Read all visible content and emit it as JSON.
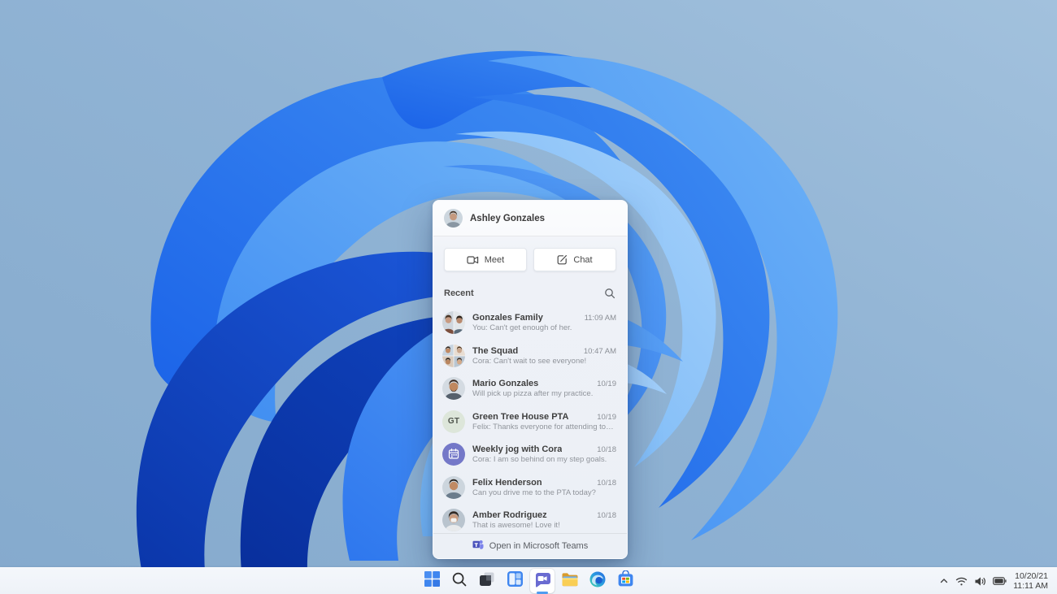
{
  "colors": {
    "accent_blue": "#2f7cf6",
    "teams_purple": "#6a6bd1",
    "wallpaper_deep_blue": "#0c3cb8",
    "taskbar_bg": "#f2f5fa"
  },
  "chat_panel": {
    "header": {
      "user_name": "Ashley Gonzales"
    },
    "actions": {
      "meet_label": "Meet",
      "chat_label": "Chat"
    },
    "recent_label": "Recent",
    "items": [
      {
        "name": "Gonzales Family",
        "preview": "You: Can't get enough of her.",
        "time": "11:09 AM",
        "avatar": "photo-pair"
      },
      {
        "name": "The Squad",
        "preview": "Cora: Can't wait to see everyone!",
        "time": "10:47 AM",
        "avatar": "photo-grid"
      },
      {
        "name": "Mario Gonzales",
        "preview": "Will pick up pizza after my practice.",
        "time": "10/19",
        "avatar": "photo"
      },
      {
        "name": "Green Tree House PTA",
        "preview": "Felix: Thanks everyone for attending today.",
        "time": "10/19",
        "avatar": "initials",
        "initials": "GT"
      },
      {
        "name": "Weekly jog with Cora",
        "preview": "Cora: I am so behind on my step goals.",
        "time": "10/18",
        "avatar": "calendar-icon"
      },
      {
        "name": "Felix Henderson",
        "preview": "Can you drive me to the PTA today?",
        "time": "10/18",
        "avatar": "photo"
      },
      {
        "name": "Amber Rodriguez",
        "preview": "That is awesome! Love it!",
        "time": "10/18",
        "avatar": "photo"
      }
    ],
    "footer": {
      "open_label": "Open in Microsoft Teams"
    }
  },
  "taskbar": {
    "icons": [
      {
        "name": "start"
      },
      {
        "name": "search"
      },
      {
        "name": "task-view"
      },
      {
        "name": "widgets"
      },
      {
        "name": "teams-chat",
        "active": true
      },
      {
        "name": "file-explorer"
      },
      {
        "name": "edge"
      },
      {
        "name": "store"
      }
    ],
    "tray": {
      "date": "10/20/21",
      "time": "11:11 AM"
    }
  }
}
